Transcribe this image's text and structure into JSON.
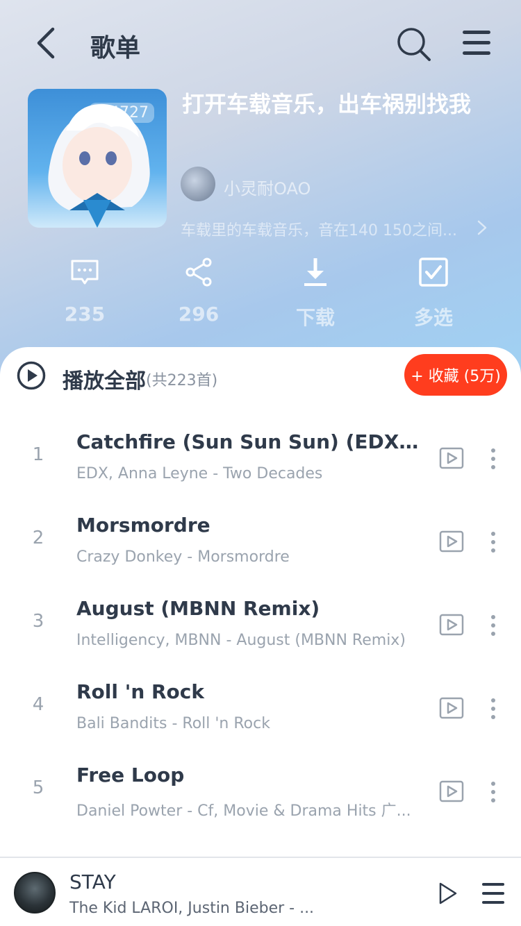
{
  "header": {
    "title": "歌单"
  },
  "playlist": {
    "cover_play_count": "4727",
    "title": "打开车载音乐，出车祸别找我",
    "creator": "小灵耐OAO",
    "description": "车载里的车载音乐，音在140 150之间..."
  },
  "actions": [
    {
      "label": "235",
      "icon": "comment-icon"
    },
    {
      "label": "296",
      "icon": "share-icon"
    },
    {
      "label": "下载",
      "icon": "download-icon"
    },
    {
      "label": "多选",
      "icon": "multiselect-icon"
    }
  ],
  "play_all": {
    "label": "播放全部",
    "count": "(共223首)",
    "collect_label": "+ 收藏 (5万)"
  },
  "tracks": [
    {
      "num": "1",
      "title": "Catchfire (Sun Sun Sun) (EDX's M...",
      "sub": "EDX, Anna Leyne - Two Decades"
    },
    {
      "num": "2",
      "title": "Morsmordre",
      "sub": "Crazy Donkey - Morsmordre"
    },
    {
      "num": "3",
      "title": "August (MBNN Remix)",
      "sub": "Intelligency, MBNN - August (MBNN Remix)"
    },
    {
      "num": "4",
      "title": "Roll 'n Rock",
      "sub": "Bali Bandits - Roll 'n Rock"
    },
    {
      "num": "5",
      "title": "Free Loop",
      "sub": "Daniel Powter - Cf, Movie & Drama Hits 广..."
    }
  ],
  "player": {
    "title": "STAY",
    "artist": "The Kid LAROI, Justin Bieber - ..."
  },
  "colors": {
    "accent": "#ff3d1e",
    "text_primary": "#2f3a4a",
    "text_secondary": "#9aa3ae"
  }
}
